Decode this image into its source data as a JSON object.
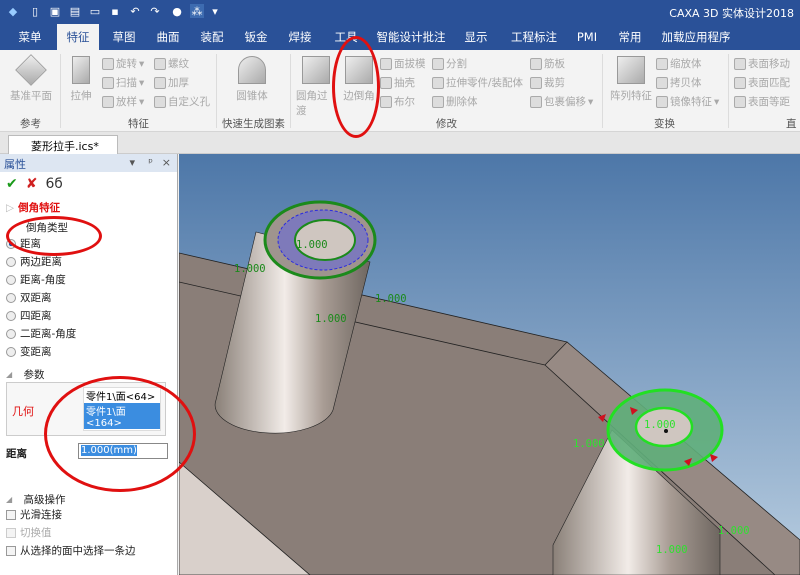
{
  "app": {
    "title": "CAXA 3D 实体设计2018"
  },
  "quick_access": [
    "logo-icon",
    "new-icon",
    "new-drawing-icon",
    "template-icon",
    "open-icon",
    "save-icon",
    "undo-icon",
    "redo-icon",
    "render-icon",
    "design-tree-icon",
    "dropdown-icon"
  ],
  "tabs": [
    "菜单",
    "特征",
    "草图",
    "曲面",
    "装配",
    "钣金",
    "焊接",
    "工具",
    "智能设计批注",
    "显示",
    "工程标注",
    "PMI",
    "常用",
    "加载应用程序"
  ],
  "ribbon": {
    "ref": {
      "plane": "基准平面",
      "group": "参考"
    },
    "feature": {
      "extrude": "拉伸",
      "revolve": "旋转",
      "sweep": "扫描",
      "loft": "放样",
      "thread": "螺纹",
      "thicken": "加厚",
      "custom_hole": "自定义孔",
      "group": "特征"
    },
    "quick": {
      "cone": "圆锥体",
      "group": "快速生成图素"
    },
    "modify": {
      "fillet": "圆角过渡",
      "chamfer": "边倒角",
      "draft": "面拔模",
      "shell": "抽壳",
      "boolean": "布尔",
      "split": "分割",
      "stretch": "拉伸零件/装配体",
      "delete": "删除体",
      "rib": "筋板",
      "trim": "裁剪",
      "wrap": "包裹偏移",
      "group": "修改"
    },
    "transform": {
      "pattern": "阵列特征",
      "scale": "缩放体",
      "copy": "拷贝体",
      "mirror": "镜像特征",
      "group": "变换"
    },
    "direct": {
      "move": "表面移动",
      "match": "表面匹配",
      "offset": "表面等距",
      "group": "直接"
    }
  },
  "doc_tab": {
    "name": "菱形拉手.ics*",
    "close": "×"
  },
  "panel": {
    "title": "属性",
    "controls": [
      "▾",
      "ᵖ",
      "×"
    ],
    "feature_title": "倒角特征",
    "type_label": "倒角类型",
    "types": [
      "距离",
      "两边距离",
      "距离-角度",
      "双距离",
      "四距离",
      "二距离-角度",
      "变距离"
    ],
    "selected_type": 0,
    "params_label": "参数",
    "geometry_label": "几何",
    "geometry_items": [
      "零件1\\面<64>",
      "零件1\\面<164>"
    ],
    "distance_label": "距离",
    "distance_value": "1.000(mm)",
    "advanced_label": "高级操作",
    "options": [
      "光滑连接",
      "切换值",
      "从选择的面中选择一条边"
    ]
  },
  "viewport": {
    "dims": [
      "1.000",
      "1.000",
      "1.000",
      "1.000",
      "1.000",
      "1.000",
      "1.000",
      "1.000"
    ]
  }
}
